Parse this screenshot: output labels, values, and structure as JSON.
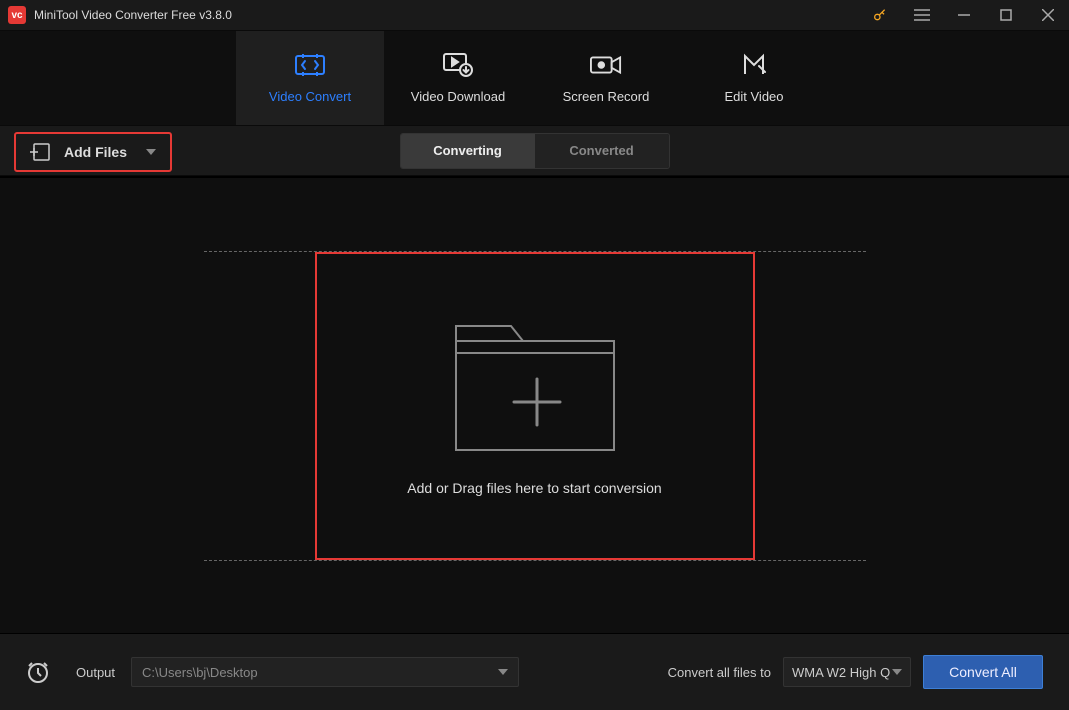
{
  "titlebar": {
    "app_logo_text": "vc",
    "title": "MiniTool Video Converter Free v3.8.0"
  },
  "nav": {
    "video_convert": "Video Convert",
    "video_download": "Video Download",
    "screen_record": "Screen Record",
    "edit_video": "Edit Video"
  },
  "toolbar": {
    "add_files_label": "Add Files",
    "tabs": {
      "converting": "Converting",
      "converted": "Converted"
    }
  },
  "dropzone": {
    "text": "Add or Drag files here to start conversion"
  },
  "footer": {
    "output_label": "Output",
    "output_path": "C:\\Users\\bj\\Desktop",
    "convert_all_files_label": "Convert all files to",
    "format_selected": "WMA W2 High Q",
    "convert_all_button": "Convert All"
  }
}
